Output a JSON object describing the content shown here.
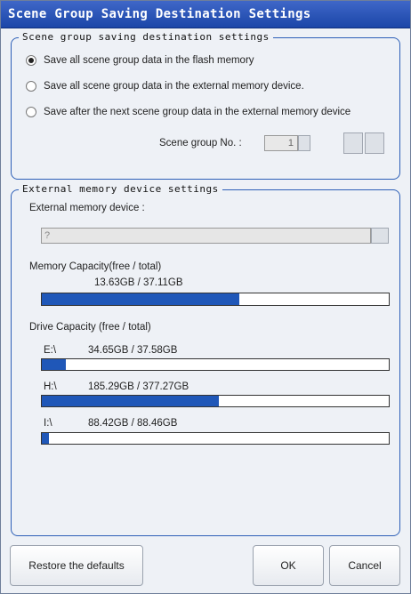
{
  "window": {
    "title": "Scene Group Saving Destination Settings"
  },
  "saving_group": {
    "legend": "Scene group saving destination settings",
    "options": [
      {
        "label": "Save all scene group data in the flash memory",
        "selected": true
      },
      {
        "label": "Save all scene group data in the external memory device.",
        "selected": false
      },
      {
        "label": "Save after the next scene group data in the external memory device",
        "selected": false
      }
    ],
    "scene_group_no_label": "Scene group No. :",
    "scene_group_no_value": "1"
  },
  "external_group": {
    "legend": "External memory device settings",
    "device_label": "External memory device :",
    "device_value": "?",
    "memory_capacity_label": "Memory Capacity(free / total)",
    "memory_capacity_value": "13.63GB / 37.11GB",
    "memory_fill_fraction": 0.57,
    "drive_capacity_label": "Drive Capacity (free / total)",
    "drives": [
      {
        "name": "E:\\",
        "value": "34.65GB / 37.58GB",
        "fill_fraction": 0.07
      },
      {
        "name": "H:\\",
        "value": "185.29GB / 377.27GB",
        "fill_fraction": 0.51
      },
      {
        "name": "I:\\",
        "value": "88.42GB / 88.46GB",
        "fill_fraction": 0.02
      }
    ]
  },
  "buttons": {
    "restore_label": "Restore the defaults",
    "ok_label": "OK",
    "cancel_label": "Cancel"
  },
  "colors": {
    "title_bar": "#2a55b8",
    "group_border": "#2d5fb7",
    "bar_fill": "#1f57b8"
  }
}
